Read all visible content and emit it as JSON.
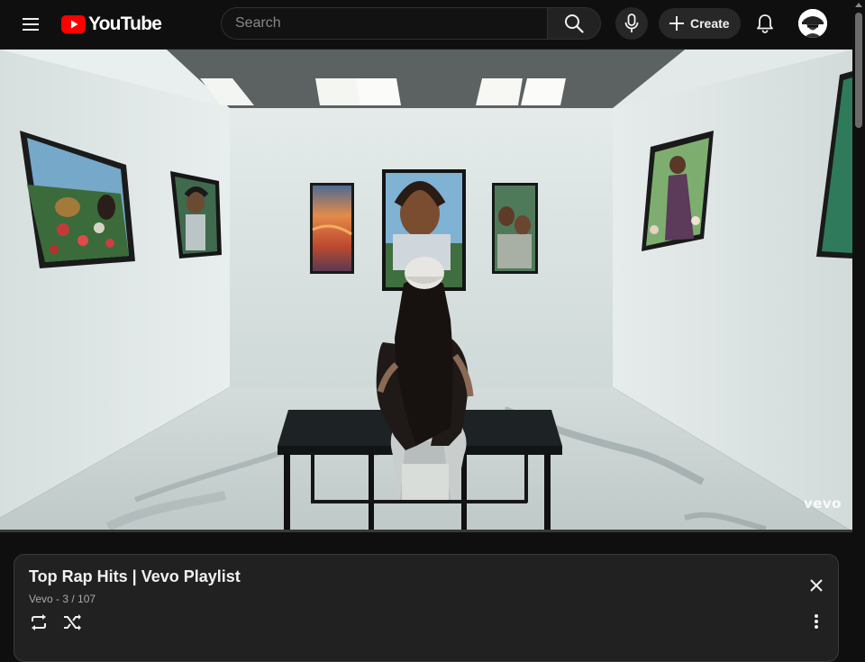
{
  "masthead": {
    "logo_text": "YouTube",
    "search": {
      "placeholder": "Search",
      "value": ""
    },
    "create_label": "Create",
    "icons": {
      "menu": "hamburger-menu-icon",
      "search": "search-icon",
      "mic": "microphone-icon",
      "create": "plus-icon",
      "notifications": "bell-icon",
      "avatar": "user-avatar"
    }
  },
  "player": {
    "watermark": "vevo",
    "progress_fraction": 0.0
  },
  "playlist": {
    "title": "Top Rap Hits | Vevo Playlist",
    "meta": "Vevo - 3 / 107",
    "icons": {
      "close": "close-icon",
      "loop": "loop-icon",
      "shuffle": "shuffle-icon",
      "more": "more-vertical-icon"
    }
  },
  "colors": {
    "background": "#0f0f0f",
    "brand_red": "#ff0000",
    "panel": "#212121",
    "text_primary": "#f1f1f1",
    "text_secondary": "#aaaaaa"
  }
}
